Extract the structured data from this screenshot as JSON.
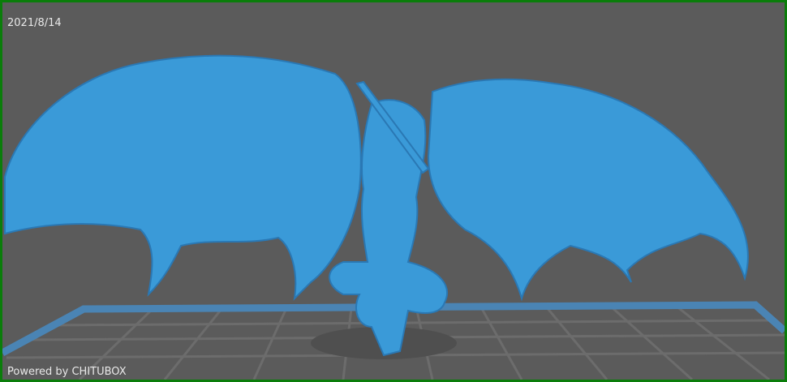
{
  "viewer": {
    "date": "2021/8/14",
    "powered_by": "Powered by CHITUBOX"
  },
  "colors": {
    "border": "#0a7d0a",
    "background": "#5b5b5b",
    "platform_edge": "#4a84b4",
    "grid": "#6a6a6a",
    "model": "#3a9ad8",
    "model_shade": "#2a78b4"
  }
}
